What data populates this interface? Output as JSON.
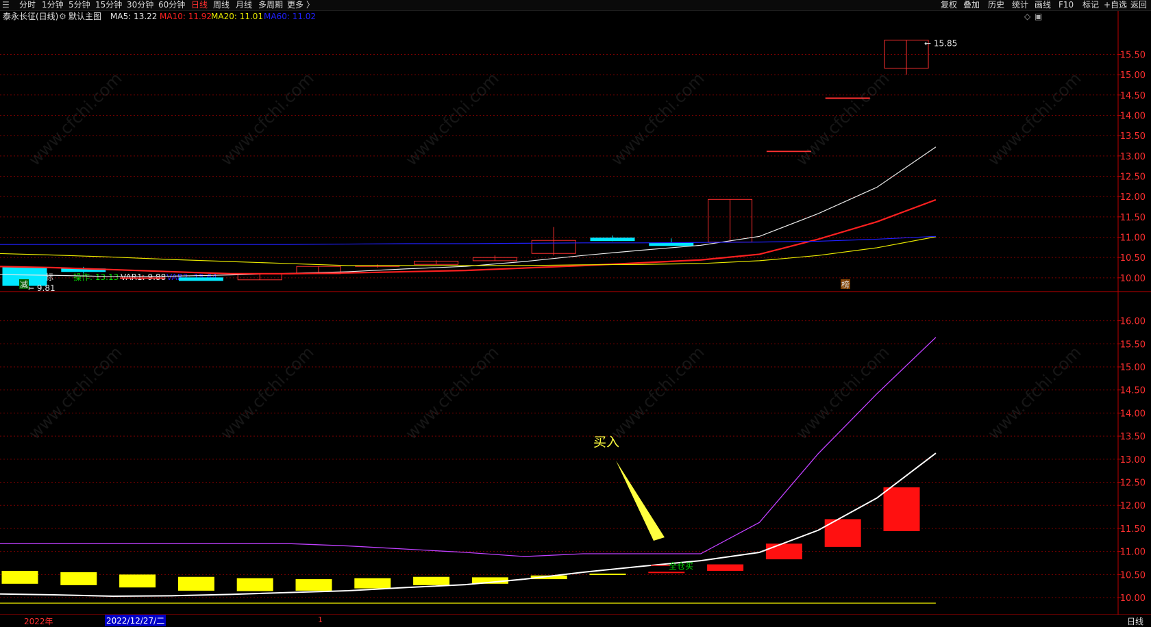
{
  "toolbar": {
    "left_icon": "menu-icon",
    "periods": [
      "分时",
      "1分钟",
      "5分钟",
      "15分钟",
      "30分钟",
      "60分钟",
      "日线",
      "周线",
      "月线",
      "多周期",
      "更多 〉"
    ],
    "active_period": "日线",
    "right_buttons": [
      "复权",
      "叠加",
      "历史",
      "统计",
      "画线",
      "F10",
      "标记",
      "+自选",
      "返回"
    ]
  },
  "main_legend": {
    "title": "泰永长征(日线)",
    "mode": "默认主图",
    "ma5": "MA5: 13.22",
    "ma10": "MA10: 11.92",
    "ma20": "MA20: 11.01",
    "ma60": "MA60: 11.02"
  },
  "sub_legend": {
    "title": "火龙虾指标",
    "op": "操作: 13.13",
    "var1": "VAR1: 9.88",
    "var2": "VAR2: 15.64"
  },
  "annotations": {
    "buy": "买入",
    "full_buy": "全仓买",
    "low_price": "9.81",
    "high_price": "15.85",
    "jian_marker": "减",
    "bang_marker": "榜"
  },
  "date_bar": {
    "year": "2022年",
    "date": "2022/12/27/二",
    "cursor": "1",
    "period_label": "日线"
  },
  "watermark_text": "www.cfchi.com",
  "colors": {
    "up": "#ff3030",
    "down": "#00e8ff",
    "ma5": "#e8e8e8",
    "ma10": "#ff2020",
    "ma20": "#e8e800",
    "ma60": "#2020ff",
    "var2": "#c040ff",
    "var1": "#e8e800",
    "op": "#ffffff",
    "grid": "#7a0000",
    "axis": "#c00000"
  },
  "chart_data": [
    {
      "type": "candlestick",
      "title": "泰永长征(日线)",
      "yticks": [
        10.0,
        10.5,
        11.0,
        11.5,
        12.0,
        12.5,
        13.0,
        13.5,
        14.0,
        14.5,
        15.0,
        15.5
      ],
      "ylim": [
        9.66,
        16.3
      ],
      "candles": [
        {
          "o": 10.25,
          "c": 9.81,
          "h": 10.25,
          "l": 9.81
        },
        {
          "o": 10.22,
          "c": 10.17,
          "h": 10.27,
          "l": 10.11
        },
        {
          "o": 10.0,
          "c": 10.0,
          "h": 10.07,
          "l": 9.95
        },
        {
          "o": 10.0,
          "c": 9.94,
          "h": 10.0,
          "l": 9.94
        },
        {
          "o": 9.95,
          "c": 10.1,
          "h": 10.1,
          "l": 9.95
        },
        {
          "o": 10.1,
          "c": 10.28,
          "h": 10.28,
          "l": 10.1
        },
        {
          "o": 10.28,
          "c": 10.3,
          "h": 10.33,
          "l": 10.25
        },
        {
          "o": 10.33,
          "c": 10.41,
          "h": 10.43,
          "l": 10.33
        },
        {
          "o": 10.42,
          "c": 10.5,
          "h": 10.55,
          "l": 10.42
        },
        {
          "o": 10.6,
          "c": 10.92,
          "h": 11.25,
          "l": 10.55
        },
        {
          "o": 10.98,
          "c": 10.93,
          "h": 11.04,
          "l": 10.9
        },
        {
          "o": 10.86,
          "c": 10.82,
          "h": 10.97,
          "l": 10.79
        },
        {
          "o": 10.88,
          "c": 11.93,
          "h": 11.93,
          "l": 10.88
        },
        {
          "o": 13.12,
          "c": 13.12,
          "h": 13.12,
          "l": 13.12
        },
        {
          "o": 14.43,
          "c": 14.43,
          "h": 14.43,
          "l": 14.43
        },
        {
          "o": 15.16,
          "c": 15.85,
          "h": 15.85,
          "l": 15.0
        }
      ],
      "series": [
        {
          "name": "MA5",
          "values": [
            10.08,
            10.06,
            10.03,
            10.04,
            10.07,
            10.11,
            10.15,
            10.22,
            10.28,
            10.4,
            10.55,
            10.68,
            10.8,
            11.02,
            11.58,
            12.23,
            13.22
          ]
        },
        {
          "name": "MA10",
          "values": [
            10.28,
            10.25,
            10.2,
            10.15,
            10.1,
            10.1,
            10.12,
            10.15,
            10.18,
            10.24,
            10.3,
            10.37,
            10.44,
            10.58,
            10.95,
            11.38,
            11.92
          ]
        },
        {
          "name": "MA20",
          "values": [
            10.6,
            10.56,
            10.51,
            10.45,
            10.4,
            10.35,
            10.3,
            10.3,
            10.3,
            10.3,
            10.32,
            10.33,
            10.35,
            10.42,
            10.55,
            10.74,
            11.01
          ]
        },
        {
          "name": "MA60",
          "values": [
            10.82,
            10.82,
            10.82,
            10.82,
            10.82,
            10.82,
            10.83,
            10.84,
            10.84,
            10.85,
            10.86,
            10.86,
            10.87,
            10.88,
            10.9,
            10.95,
            11.02
          ]
        }
      ]
    },
    {
      "type": "indicator",
      "title": "火龙虾指标",
      "yticks": [
        10.0,
        10.5,
        11.0,
        11.5,
        12.0,
        12.5,
        13.0,
        13.5,
        14.0,
        14.5,
        15.0,
        15.5,
        16.0
      ],
      "ylim": [
        9.63,
        16.35
      ],
      "series": [
        {
          "name": "操作",
          "values": [
            10.08,
            10.06,
            10.03,
            10.04,
            10.07,
            10.11,
            10.15,
            10.22,
            10.28,
            10.4,
            10.55,
            10.68,
            10.8,
            10.98,
            11.46,
            12.16,
            13.13
          ]
        },
        {
          "name": "VAR1",
          "values": [
            9.88,
            9.88,
            9.88,
            9.88,
            9.88,
            9.88,
            9.88,
            9.88,
            9.88,
            9.88,
            9.88,
            9.88,
            9.88,
            9.88,
            9.88,
            9.88,
            9.88
          ]
        },
        {
          "name": "VAR2",
          "values": [
            11.17,
            11.17,
            11.17,
            11.17,
            11.17,
            11.17,
            11.12,
            11.05,
            10.98,
            10.89,
            10.95,
            10.95,
            10.95,
            11.63,
            13.12,
            14.42,
            15.64
          ]
        }
      ],
      "bars": [
        {
          "lo": 10.3,
          "hi": 10.58,
          "color": "yellow"
        },
        {
          "lo": 10.27,
          "hi": 10.55,
          "color": "yellow"
        },
        {
          "lo": 10.22,
          "hi": 10.5,
          "color": "yellow"
        },
        {
          "lo": 10.15,
          "hi": 10.45,
          "color": "yellow"
        },
        {
          "lo": 10.14,
          "hi": 10.42,
          "color": "yellow"
        },
        {
          "lo": 10.15,
          "hi": 10.4,
          "color": "yellow"
        },
        {
          "lo": 10.2,
          "hi": 10.42,
          "color": "yellow"
        },
        {
          "lo": 10.27,
          "hi": 10.45,
          "color": "yellow"
        },
        {
          "lo": 10.3,
          "hi": 10.44,
          "color": "yellow"
        },
        {
          "lo": 10.4,
          "hi": 10.48,
          "color": "yellow"
        },
        {
          "lo": 10.5,
          "hi": 10.52,
          "color": "yellow"
        },
        {
          "lo": 10.54,
          "hi": 10.56,
          "color": "red"
        },
        {
          "lo": 10.58,
          "hi": 10.72,
          "color": "red"
        },
        {
          "lo": 10.83,
          "hi": 11.17,
          "color": "red"
        },
        {
          "lo": 11.1,
          "hi": 11.7,
          "color": "red"
        },
        {
          "lo": 11.44,
          "hi": 12.39,
          "color": "red"
        }
      ]
    }
  ]
}
